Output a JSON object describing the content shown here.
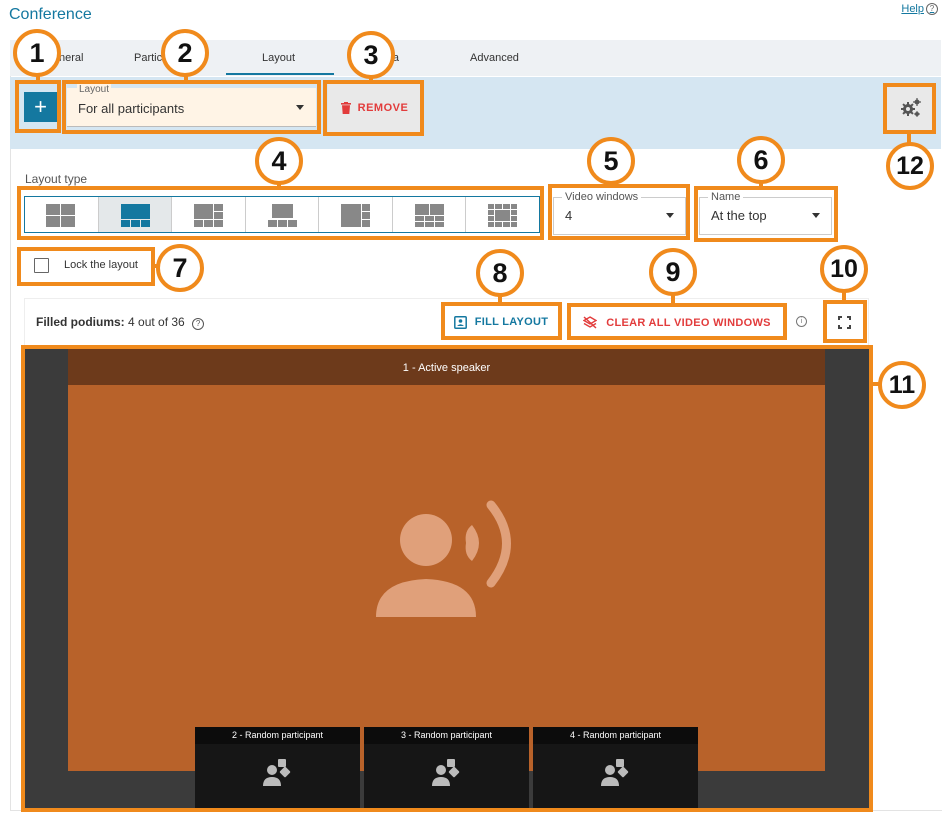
{
  "app_title": "Conference",
  "help_label": "Help",
  "help_icon": "?",
  "tabs": [
    {
      "label": "General"
    },
    {
      "label": "Participants"
    },
    {
      "label": "Layout"
    },
    {
      "label": "Media"
    },
    {
      "label": "Advanced"
    }
  ],
  "tabs_visible": [
    "neral",
    "Partic",
    "Layout",
    "lia",
    "Advanced"
  ],
  "toolbar": {
    "add_glyph": "+",
    "layout_label": "Layout",
    "layout_value": "For all participants",
    "remove_label": "REMOVE"
  },
  "layout_type_label": "Layout type",
  "layout_options": [
    "2x2 grid",
    "1 large + 3 small",
    "1 + side columns",
    "1 + row of 3",
    "1 + right column",
    "2 + row of small",
    "grid with center"
  ],
  "selected_layout_index": 1,
  "video_windows": {
    "label": "Video windows",
    "value": "4"
  },
  "name_position": {
    "label": "Name",
    "value": "At the top"
  },
  "lock_label": "Lock the layout",
  "podiums": {
    "label": "Filled podiums:",
    "value": "4 out of 36"
  },
  "fill_layout_label": "FILL LAYOUT",
  "clear_windows_label": "CLEAR ALL VIDEO WINDOWS",
  "info_icon": "i",
  "canvas": {
    "active_speaker": "1 - Active speaker",
    "thumbnails": [
      {
        "label": "2 - Random participant"
      },
      {
        "label": "3 - Random participant"
      },
      {
        "label": "4 - Random participant"
      }
    ]
  },
  "callouts": [
    "1",
    "2",
    "3",
    "4",
    "5",
    "6",
    "7",
    "8",
    "9",
    "10",
    "11",
    "12"
  ],
  "colors": {
    "accent": "#1478a0",
    "callout": "#f08a1c",
    "danger": "#e23c3c",
    "speaker_bg": "#b8622a"
  }
}
